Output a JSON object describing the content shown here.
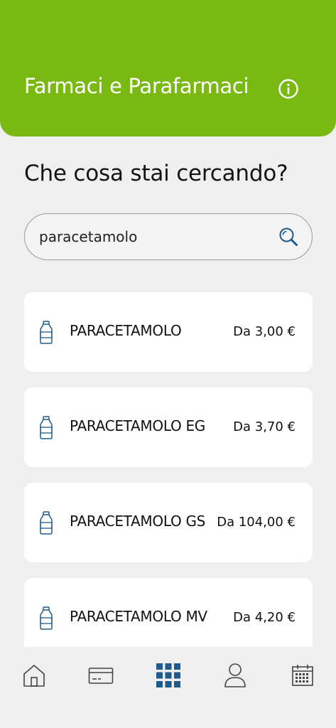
{
  "header": {
    "title": "Farmaci e Parafarmaci",
    "info_icon": "info-circle-icon"
  },
  "colors": {
    "header_bg": "#7ab912",
    "icon_blue": "#1e5a8c",
    "page_bg": "#efefef"
  },
  "question": "Che cosa stai cercando?",
  "search": {
    "value": "paracetamolo",
    "icon": "search-icon"
  },
  "results": [
    {
      "name": "PARACETAMOLO",
      "price": "Da 3,00 €",
      "icon": "bottle-icon"
    },
    {
      "name": "PARACETAMOLO EG",
      "price": "Da 3,70 €",
      "icon": "bottle-icon"
    },
    {
      "name": "PARACETAMOLO GS",
      "price": "Da 104,00 €",
      "icon": "bottle-icon"
    },
    {
      "name": "PARACETAMOLO MV",
      "price": "Da 4,20 €",
      "icon": "bottle-icon"
    }
  ],
  "tabbar": [
    {
      "icon": "home-icon",
      "active": false
    },
    {
      "icon": "card-icon",
      "active": false
    },
    {
      "icon": "grid-icon",
      "active": true
    },
    {
      "icon": "user-icon",
      "active": false
    },
    {
      "icon": "calendar-icon",
      "active": false
    }
  ]
}
